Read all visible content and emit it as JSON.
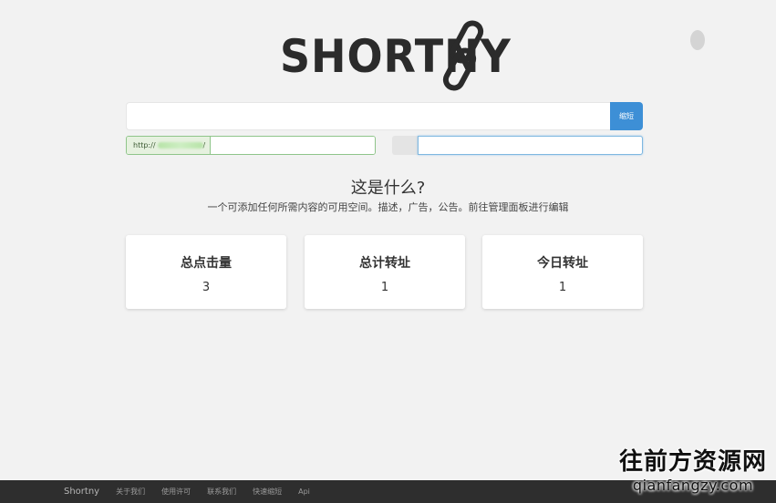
{
  "logo": {
    "text": "SHORTNY",
    "icon": "chain-link-icon"
  },
  "header": {
    "avatar_icon": "user-circle-icon"
  },
  "shorten": {
    "url_placeholder": "",
    "button_label": "缩短",
    "button_color": "#3d8fd6"
  },
  "alias": {
    "prefix": "http://",
    "prefix_suffix": "/",
    "value": ""
  },
  "password": {
    "value": ""
  },
  "info": {
    "heading": "这是什么?",
    "description": "一个可添加任何所需内容的可用空间。描述，广告，公告。前往管理面板进行编辑"
  },
  "stats": [
    {
      "label": "总点击量",
      "value": "3"
    },
    {
      "label": "总计转址",
      "value": "1"
    },
    {
      "label": "今日转址",
      "value": "1"
    }
  ],
  "footer": {
    "brand": "Shortny",
    "links": [
      "关于我们",
      "使用许可",
      "联系我们",
      "快速缩短",
      "Api"
    ]
  },
  "watermark": {
    "title": "往前方资源网",
    "subtitle": "qianfangzy.com"
  }
}
